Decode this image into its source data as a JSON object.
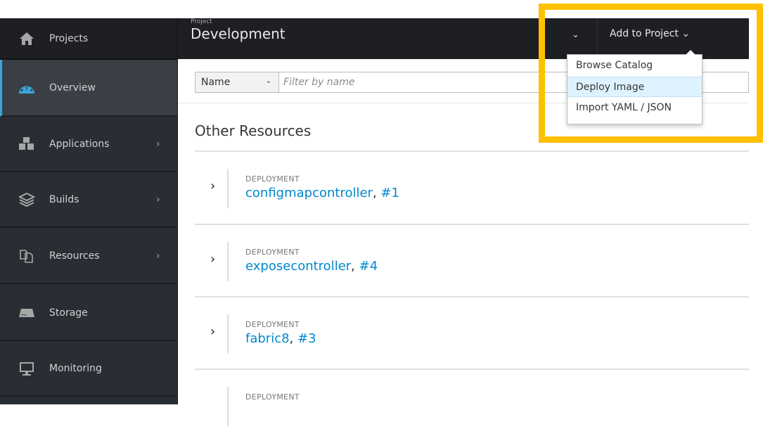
{
  "sidebar": {
    "items": [
      {
        "label": "Projects",
        "icon": "home-icon"
      },
      {
        "label": "Overview",
        "icon": "dashboard-icon"
      },
      {
        "label": "Applications",
        "icon": "cubes-icon",
        "has_submenu": true
      },
      {
        "label": "Builds",
        "icon": "builds-icon",
        "has_submenu": true
      },
      {
        "label": "Resources",
        "icon": "resources-icon",
        "has_submenu": true
      },
      {
        "label": "Storage",
        "icon": "storage-icon"
      },
      {
        "label": "Monitoring",
        "icon": "monitor-icon"
      }
    ],
    "active": "Overview"
  },
  "header": {
    "project_label": "Project",
    "project_name": "Development",
    "add_to_project": "Add to Project"
  },
  "add_menu": {
    "items": [
      "Browse Catalog",
      "Deploy Image",
      "Import YAML / JSON"
    ],
    "highlighted": "Deploy Image"
  },
  "filter": {
    "selected": "Name",
    "placeholder": "Filter by name"
  },
  "section": {
    "title": "Other Resources"
  },
  "resources": [
    {
      "kind": "DEPLOYMENT",
      "name": "configmapcontroller",
      "rev": "#1"
    },
    {
      "kind": "DEPLOYMENT",
      "name": "exposecontroller",
      "rev": "#4"
    },
    {
      "kind": "DEPLOYMENT",
      "name": "fabric8",
      "rev": "#3"
    },
    {
      "kind": "DEPLOYMENT"
    }
  ],
  "colors": {
    "accent": "#0088ce",
    "highlight": "#ffc000",
    "nav_active": "#39a5dc"
  }
}
